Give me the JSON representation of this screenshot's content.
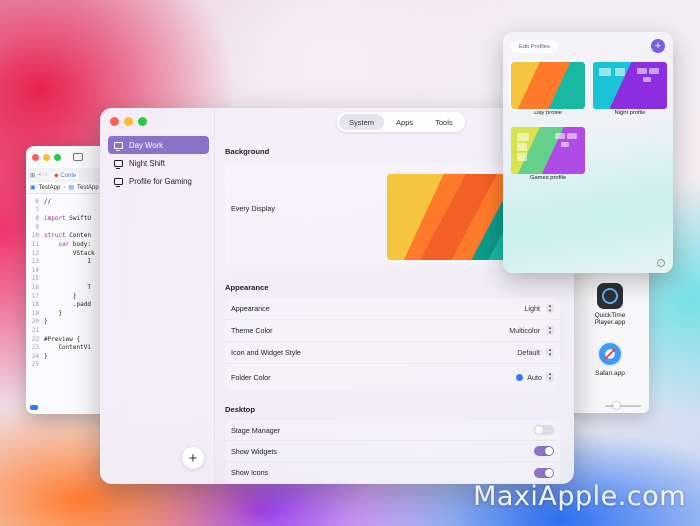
{
  "xcode": {
    "tab": "Conte",
    "breadcrumb": [
      "TestApp",
      "TestApp"
    ],
    "lines": [
      {
        "n": "6",
        "t": "//"
      },
      {
        "n": "7",
        "t": ""
      },
      {
        "n": "8",
        "t": "import SwiftU"
      },
      {
        "n": "9",
        "t": ""
      },
      {
        "n": "10",
        "t": "struct Conten"
      },
      {
        "n": "11",
        "t": "    var body:"
      },
      {
        "n": "12",
        "t": "        VStack"
      },
      {
        "n": "13",
        "t": "            I"
      },
      {
        "n": "14",
        "t": ""
      },
      {
        "n": "15",
        "t": ""
      },
      {
        "n": "16",
        "t": "            T"
      },
      {
        "n": "17",
        "t": "        }"
      },
      {
        "n": "18",
        "t": "        .padd"
      },
      {
        "n": "19",
        "t": "    }"
      },
      {
        "n": "20",
        "t": "}"
      },
      {
        "n": "21",
        "t": ""
      },
      {
        "n": "22",
        "t": "#Preview {"
      },
      {
        "n": "23",
        "t": "    ContentVi"
      },
      {
        "n": "24",
        "t": "}"
      },
      {
        "n": "25",
        "t": ""
      }
    ]
  },
  "finder": {
    "apps": [
      {
        "label": "QuickTime Player.app",
        "icon": "quicktime-icon"
      },
      {
        "label": "Safari.app",
        "icon": "safari-icon"
      }
    ]
  },
  "sidebar": {
    "profiles": [
      {
        "label": "Day Work",
        "selected": true
      },
      {
        "label": "Night Shift",
        "selected": false
      },
      {
        "label": "Profile for Gaming",
        "selected": false
      }
    ],
    "add_label": "+"
  },
  "tabs": [
    {
      "label": "System",
      "active": true
    },
    {
      "label": "Apps",
      "active": false
    },
    {
      "label": "Tools",
      "active": false
    }
  ],
  "background": {
    "title": "Background",
    "every_display": "Every Display"
  },
  "appearance": {
    "title": "Appearance",
    "rows": [
      {
        "label": "Appearance",
        "value": "Light"
      },
      {
        "label": "Theme Color",
        "value": "Multicolor"
      },
      {
        "label": "Icon and Widget Style",
        "value": "Default"
      },
      {
        "label": "Folder Color",
        "value": "Auto",
        "color": "#2f7bf6"
      }
    ]
  },
  "desktop": {
    "title": "Desktop",
    "rows": [
      {
        "label": "Stage Manager",
        "on": false
      },
      {
        "label": "Show Widgets",
        "on": true
      },
      {
        "label": "Show Icons",
        "on": true
      }
    ]
  },
  "popover": {
    "edit_label": "Edit Profiles",
    "add_label": "+",
    "profiles": [
      {
        "label": "Day profile"
      },
      {
        "label": "Night profile"
      },
      {
        "label": "Games profile"
      }
    ]
  },
  "watermark": "MaxiApple.com",
  "colors": {
    "accent": "#8a72c9",
    "popover_add": "#7b5ee0",
    "close": "#ff5f57",
    "minimize": "#febc2e",
    "zoom": "#28c840"
  }
}
